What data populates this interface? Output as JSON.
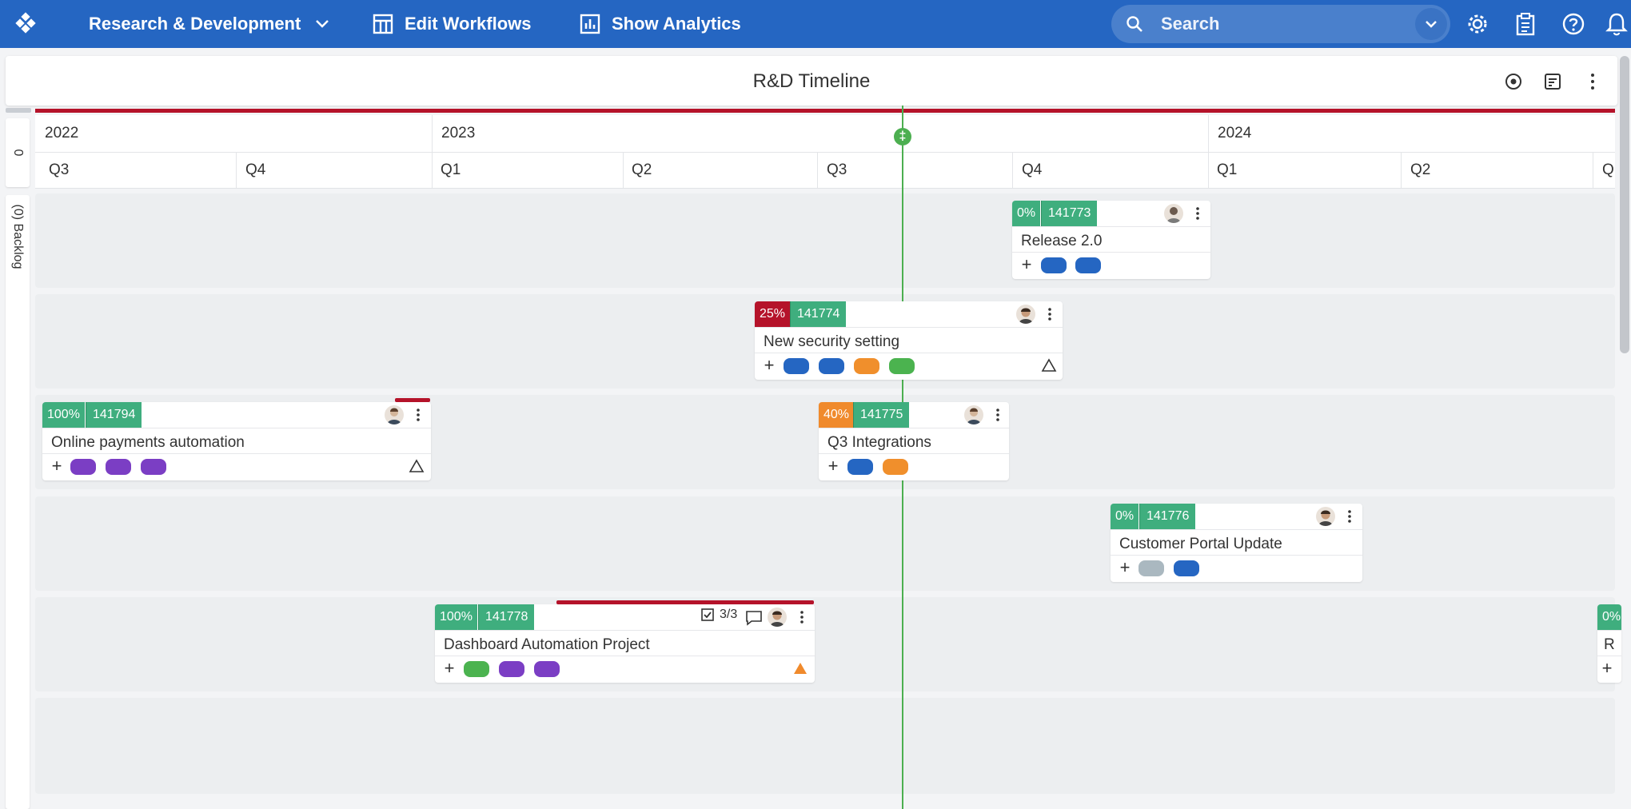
{
  "topbar": {
    "workspace": "Research & Development",
    "edit_workflows": "Edit Workflows",
    "show_analytics": "Show Analytics",
    "search_placeholder": "Search"
  },
  "board": {
    "title": "R&D Timeline"
  },
  "rails": {
    "top_label": "0",
    "backlog_label": "(0) Backlog"
  },
  "timeline": {
    "years": [
      "2022",
      "2023",
      "2024"
    ],
    "quarters": [
      "Q3",
      "Q4",
      "Q1",
      "Q2",
      "Q3",
      "Q4",
      "Q1",
      "Q2",
      "Q"
    ]
  },
  "colors": {
    "brand": "#2566c2",
    "green": "#3fae7e",
    "red": "#b5132a",
    "orange": "#f08a2c",
    "blue_tag": "#2566c2",
    "purple_tag": "#7b3ec4",
    "green_tag": "#4bb34f",
    "orange_tag": "#f08f2c",
    "gray_tag": "#aab8c0"
  },
  "cards": [
    {
      "percent": "0%",
      "id": "141773",
      "title": "Release 2.0"
    },
    {
      "percent": "25%",
      "id": "141774",
      "title": "New security setting"
    },
    {
      "percent": "100%",
      "id": "141794",
      "title": "Online payments automation"
    },
    {
      "percent": "40%",
      "id": "141775",
      "title": "Q3 Integrations"
    },
    {
      "percent": "0%",
      "id": "141776",
      "title": "Customer Portal Update"
    },
    {
      "percent": "100%",
      "id": "141778",
      "title": "Dashboard Automation Project",
      "checklist": "3/3"
    },
    {
      "percent": "0%",
      "id": "",
      "title": "R"
    }
  ]
}
